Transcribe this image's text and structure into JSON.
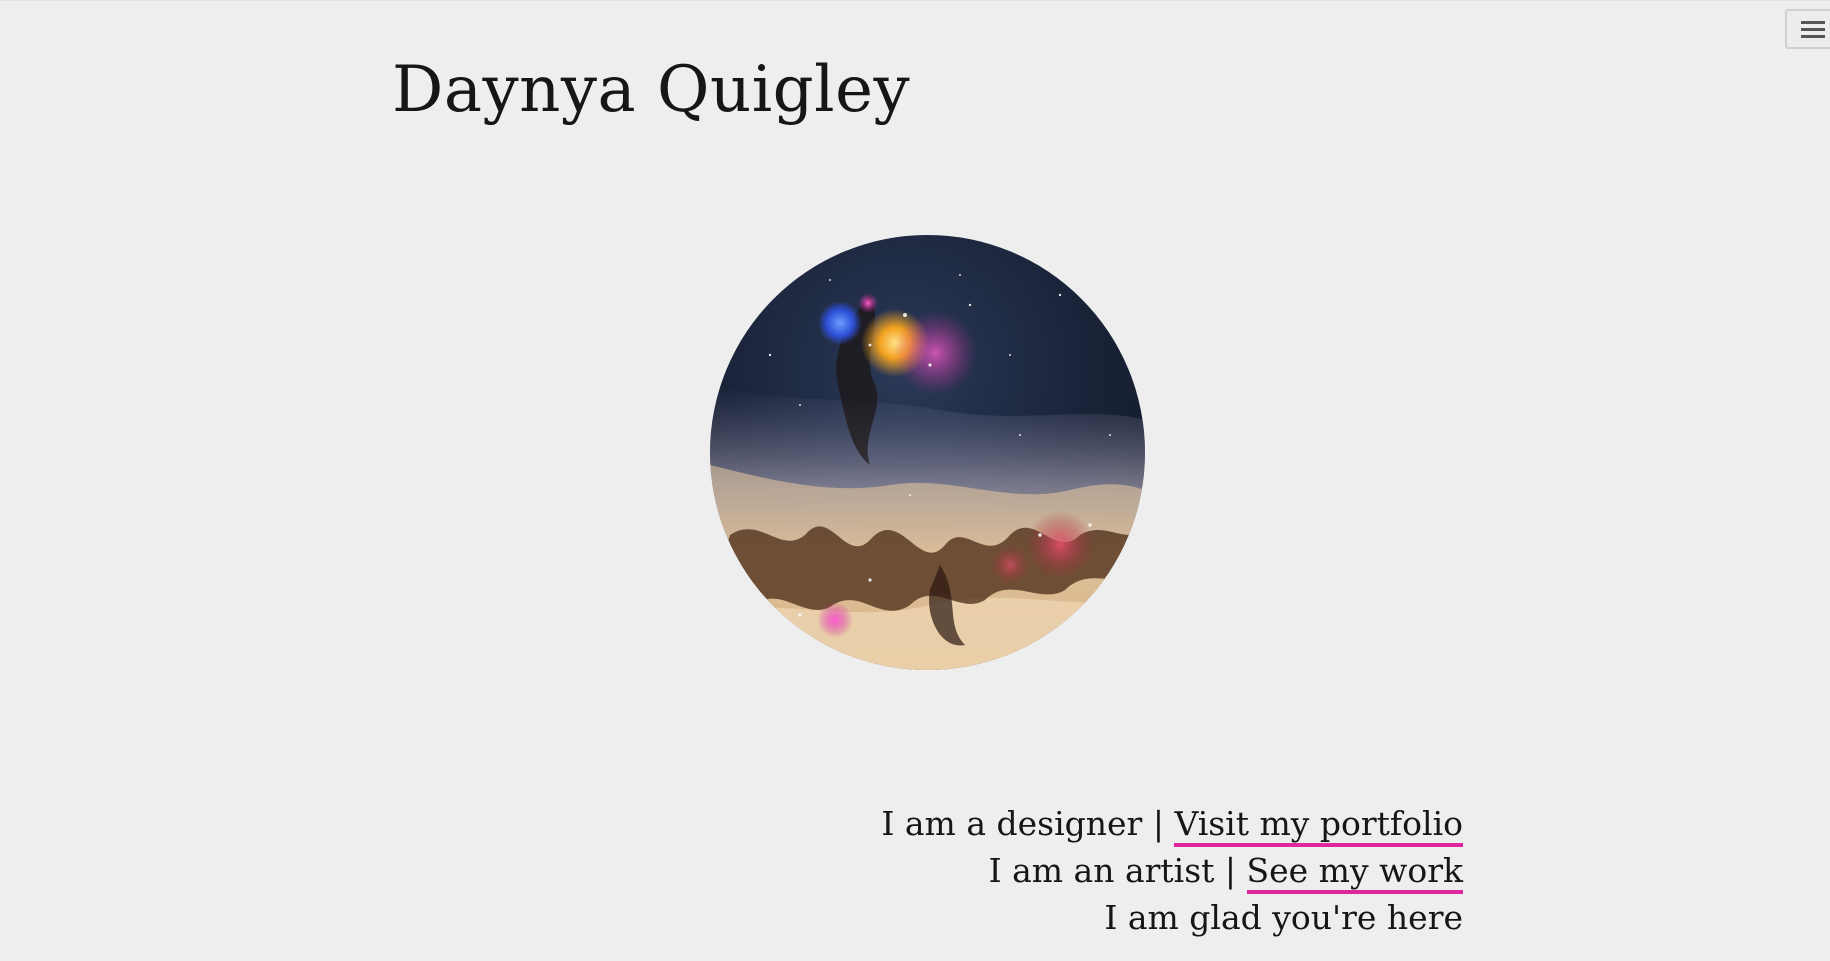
{
  "site": {
    "title": "Daynya Quigley"
  },
  "nav": {
    "menu_icon": "hamburger-menu-icon"
  },
  "hero": {
    "image": "circular galaxy painting"
  },
  "tagline": {
    "line1_text": "I am a designer | ",
    "line1_link": "Visit my portfolio",
    "line2_text": "I am an artist | ",
    "line2_link": "See my work",
    "line3_text": "I am glad you're here"
  },
  "colors": {
    "background": "#eeeeee",
    "text": "#161616",
    "link_underline": "#e0269e"
  }
}
